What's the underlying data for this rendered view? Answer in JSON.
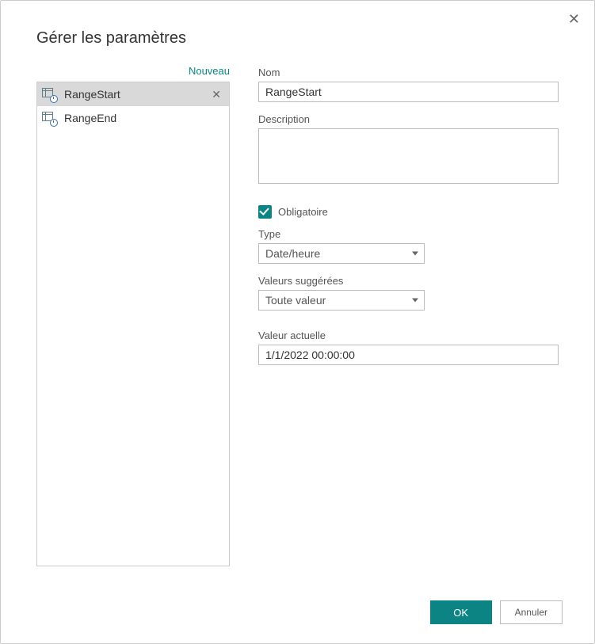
{
  "dialog": {
    "title": "Gérer les paramètres",
    "new_label": "Nouveau"
  },
  "params": [
    {
      "name": "RangeStart",
      "selected": true
    },
    {
      "name": "RangeEnd",
      "selected": false
    }
  ],
  "form": {
    "name_label": "Nom",
    "name_value": "RangeStart",
    "description_label": "Description",
    "description_value": "",
    "required_label": "Obligatoire",
    "required_checked": true,
    "type_label": "Type",
    "type_value": "Date/heure",
    "suggested_label": "Valeurs suggérées",
    "suggested_value": "Toute valeur",
    "current_label": "Valeur actuelle",
    "current_value": "1/1/2022 00:00:00"
  },
  "buttons": {
    "ok": "OK",
    "cancel": "Annuler"
  }
}
